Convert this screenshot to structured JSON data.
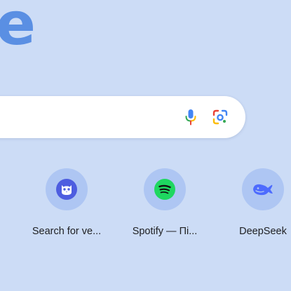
{
  "logo": {
    "text": "e",
    "color": "#5a8fe3"
  },
  "search": {
    "value": "",
    "mic_icon": "microphone-icon",
    "lens_icon": "google-lens-icon"
  },
  "shortcuts": [
    {
      "label": "Search for ve...",
      "icon": "owl-icon",
      "icon_bg": "#4d5de0"
    },
    {
      "label": "Spotify — Пі...",
      "icon": "spotify-icon",
      "icon_bg": "#1ed760"
    },
    {
      "label": "DeepSeek",
      "icon": "deepseek-whale-icon",
      "icon_bg": "#4d6bfe"
    }
  ],
  "colors": {
    "page_background": "#ccdcf6",
    "tile_background": "#aec6f3"
  }
}
